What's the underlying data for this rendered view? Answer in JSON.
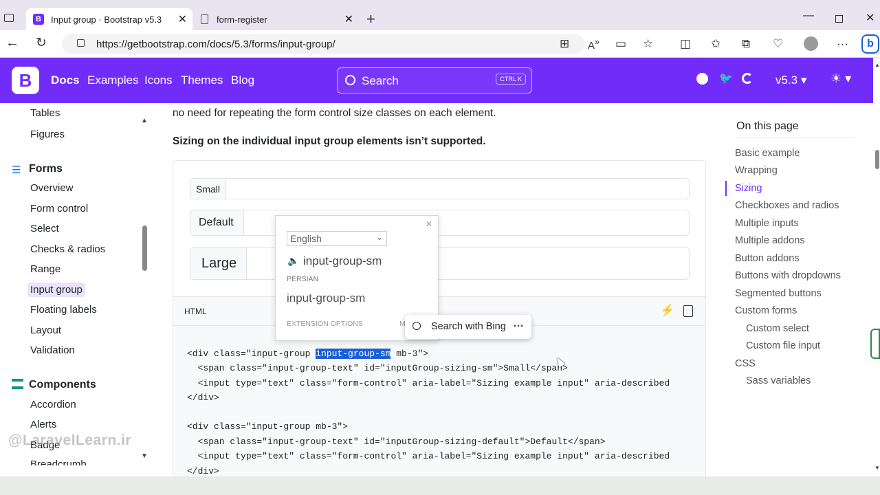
{
  "browser": {
    "tabs": [
      {
        "title": "Input group · Bootstrap v5.3"
      },
      {
        "title": "form-register"
      }
    ],
    "url": "https://getbootstrap.com/docs/5.3/forms/input-group/"
  },
  "navbar": {
    "logo": "B",
    "links": [
      "Docs",
      "Examples",
      "Icons",
      "Themes",
      "Blog"
    ],
    "search_placeholder": "Search",
    "search_kbd": "CTRL K",
    "version": "v5.3"
  },
  "sidebar": {
    "top_items": [
      "Tables",
      "Figures"
    ],
    "forms_heading": "Forms",
    "forms_items": [
      "Overview",
      "Form control",
      "Select",
      "Checks & radios",
      "Range",
      "Input group",
      "Floating labels",
      "Layout",
      "Validation"
    ],
    "components_heading": "Components",
    "components_items": [
      "Accordion",
      "Alerts",
      "Badge",
      "Breadcrumb"
    ]
  },
  "main": {
    "intro": "no need for repeating the form control size classes on each element.",
    "bold_note": "Sizing on the individual input group elements isn’t supported.",
    "examples": [
      "Small",
      "Default",
      "Large"
    ],
    "code_lang": "HTML",
    "code_lines": [
      "<div class=\"input-group ",
      "input-group-sm",
      " mb-3\">",
      "  <span class=\"input-group-text\" id=\"inputGroup-sizing-sm\">Small</span>",
      "  <input type=\"text\" class=\"form-control\" aria-label=\"Sizing example input\" aria-described",
      "</div>",
      "<div class=\"input-group mb-3\">",
      "  <span class=\"input-group-text\" id=\"inputGroup-sizing-default\">Default</span>",
      "  <input type=\"text\" class=\"form-control\" aria-label=\"Sizing example input\" aria-described",
      "</div>"
    ]
  },
  "toc": {
    "heading": "On this page",
    "items": [
      "Basic example",
      "Wrapping",
      "Sizing",
      "Checkboxes and radios",
      "Multiple inputs",
      "Multiple addons",
      "Button addons",
      "Buttons with dropdowns",
      "Segmented buttons",
      "Custom forms",
      "Custom select",
      "Custom file input",
      "CSS",
      "Sass variables"
    ]
  },
  "translate_popup": {
    "language": "English",
    "source_text": "input-group-sm",
    "target_lang": "PERSIAN",
    "translated_text": "input-group-sm",
    "options_label": "EXTENSION OPTIONS",
    "more_label": "M"
  },
  "bing_button": {
    "label": "Search with Bing",
    "more": "···"
  },
  "watermark": "@LaravelLearn.ir",
  "colors": {
    "brand": "#712cf9",
    "highlight": "#1a5fd6"
  }
}
